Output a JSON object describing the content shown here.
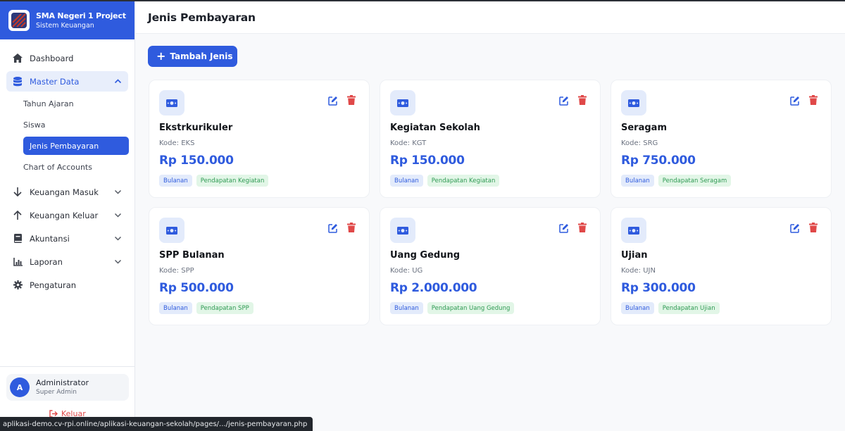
{
  "app": {
    "title": "SMA Negeri 1 Project",
    "subtitle": "Sistem Keuangan"
  },
  "sidebar": {
    "dashboard": "Dashboard",
    "master_data": "Master Data",
    "sub_items": [
      "Tahun Ajaran",
      "Siswa",
      "Jenis Pembayaran",
      "Chart of Accounts"
    ],
    "keuangan_masuk": "Keuangan Masuk",
    "keuangan_keluar": "Keuangan Keluar",
    "akuntansi": "Akuntansi",
    "laporan": "Laporan",
    "pengaturan": "Pengaturan"
  },
  "user": {
    "initial": "A",
    "name": "Administrator",
    "role": "Super Admin",
    "logout": "Keluar"
  },
  "header": {
    "title": "Jenis Pembayaran"
  },
  "actions": {
    "add_label": "Tambah Jenis"
  },
  "cards": [
    {
      "name": "Ekstrkurikuler",
      "code": "Kode: EKS",
      "price": "Rp 150.000",
      "period": "Bulanan",
      "account": "Pendapatan Kegiatan"
    },
    {
      "name": "Kegiatan Sekolah",
      "code": "Kode: KGT",
      "price": "Rp 150.000",
      "period": "Bulanan",
      "account": "Pendapatan Kegiatan"
    },
    {
      "name": "Seragam",
      "code": "Kode: SRG",
      "price": "Rp 750.000",
      "period": "Bulanan",
      "account": "Pendapatan Seragam"
    },
    {
      "name": "SPP Bulanan",
      "code": "Kode: SPP",
      "price": "Rp 500.000",
      "period": "Bulanan",
      "account": "Pendapatan SPP"
    },
    {
      "name": "Uang Gedung",
      "code": "Kode: UG",
      "price": "Rp 2.000.000",
      "period": "Bulanan",
      "account": "Pendapatan Uang Gedung"
    },
    {
      "name": "Ujian",
      "code": "Kode: UJN",
      "price": "Rp 300.000",
      "period": "Bulanan",
      "account": "Pendapatan Ujian"
    }
  ],
  "status_url": "aplikasi-demo.cv-rpi.online/aplikasi-keuangan-sekolah/pages/.../jenis-pembayaran.php",
  "colors": {
    "primary": "#2f5bde",
    "danger": "#e04848",
    "success": "#2f9a53"
  },
  "icons": {
    "brand": "striped-logo-icon",
    "card": "money-bill-icon",
    "edit": "edit-icon",
    "delete": "trash-icon"
  }
}
